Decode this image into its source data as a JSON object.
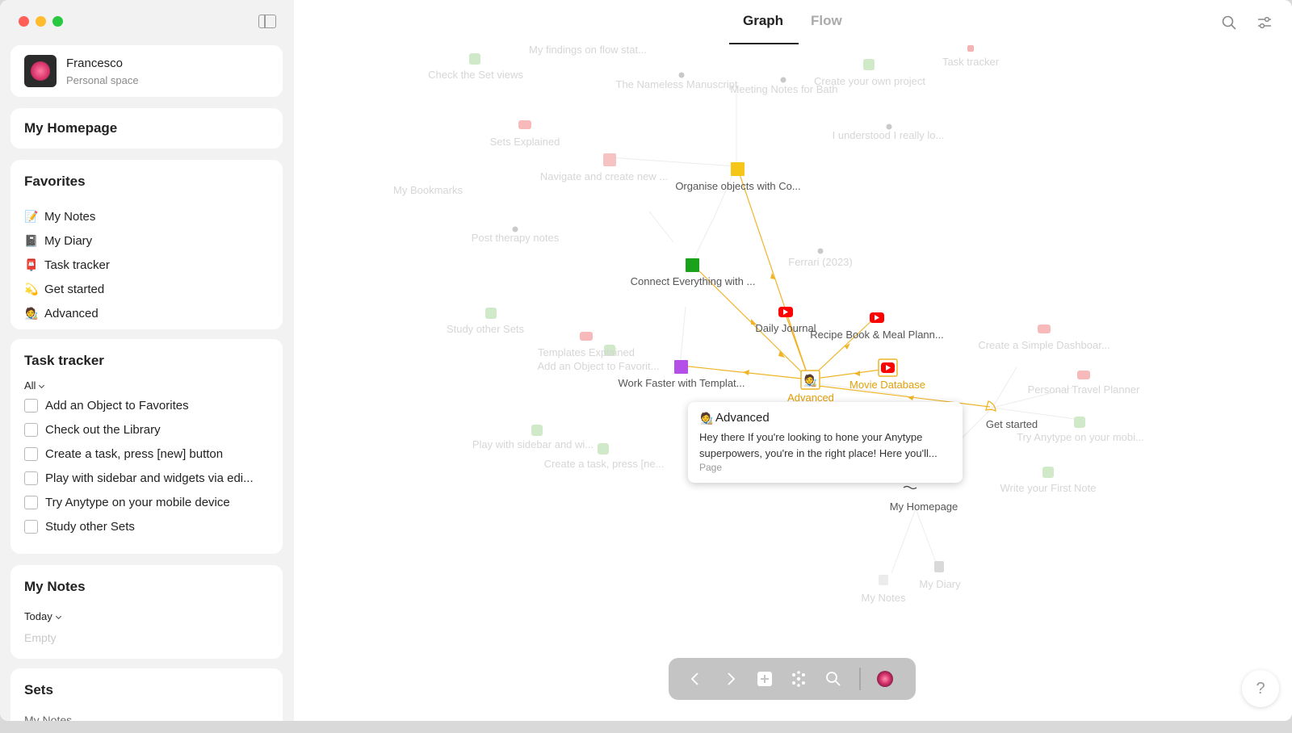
{
  "profile": {
    "name": "Francesco",
    "subtitle": "Personal space"
  },
  "homepage": {
    "title": "My Homepage"
  },
  "favorites": {
    "title": "Favorites",
    "items": [
      {
        "icon": "notepad-icon",
        "glyph": "📝",
        "label": "My Notes"
      },
      {
        "icon": "notebook-icon",
        "glyph": "📓",
        "label": "My Diary"
      },
      {
        "icon": "mailbox-icon",
        "glyph": "📮",
        "label": "Task tracker"
      },
      {
        "icon": "comet-icon",
        "glyph": "💫",
        "label": "Get started"
      },
      {
        "icon": "artist-icon",
        "glyph": "🧑‍🎨",
        "label": "Advanced"
      }
    ]
  },
  "task_tracker": {
    "title": "Task tracker",
    "filter": "All",
    "items": [
      "Add an Object to Favorites",
      "Check out the Library",
      "Create a task, press [new] button",
      "Play with sidebar and widgets via edi...",
      "Try Anytype on your mobile device",
      "Study other Sets"
    ]
  },
  "my_notes": {
    "title": "My Notes",
    "filter": "Today",
    "empty": "Empty"
  },
  "sets": {
    "title": "Sets",
    "first_item": "My Notes"
  },
  "tabs": {
    "graph": "Graph",
    "flow": "Flow"
  },
  "graph": {
    "faded_labels": [
      "My findings on flow stat...",
      "Check the Set views",
      "The Nameless Manuscript",
      "Meeting Notes for Bath",
      "Create your own project",
      "Task tracker",
      "I understood I really lo...",
      "Sets Explained",
      "My Bookmarks",
      "Navigate and create new ...",
      "Post therapy notes",
      "Ferrari (2023)",
      "Study other Sets",
      "Templates Explained",
      "Add an Object to Favorit...",
      "Create a Simple Dashboar...",
      "Personal Travel Planner",
      "Try Anytype on your mobi...",
      "Play with sidebar and wi...",
      "Create a task, press [ne...",
      "Write your First Note",
      "My Notes",
      "My Diary"
    ],
    "active_labels": [
      "Organise objects with Co...",
      "Connect Everything with ...",
      "Daily Journal",
      "Recipe Book & Meal Plann...",
      "Work Faster with Templat...",
      "Get started",
      "My Homepage"
    ],
    "selected_label": "Advanced",
    "highlight_label": "Movie Database",
    "edge_color": "#f0b429"
  },
  "tooltip": {
    "title": "Advanced",
    "body": "Hey there If you're looking to hone your Anytype superpowers, you're in the right place! Here you'll...",
    "type": "Page"
  },
  "help": "?"
}
